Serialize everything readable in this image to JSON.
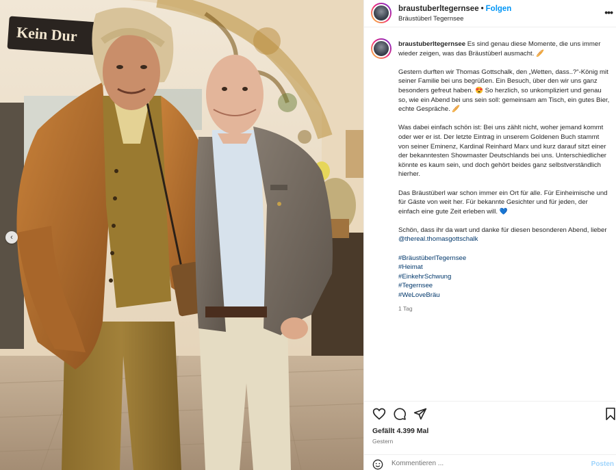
{
  "photo": {
    "sign_text": "Kein Dur",
    "alt_subject": "two men posing"
  },
  "header": {
    "username": "braustuberltegernsee",
    "separator": "•",
    "follow_label": "Folgen",
    "location": "Bräustüberl Tegernsee",
    "more_icon": "more-horizontal-icon"
  },
  "caption": {
    "username": "braustuberltegernsee",
    "paragraphs": [
      "Es sind genau diese Momente, die uns immer wieder zeigen, was das Bräustüberl ausmacht. 🥖",
      "Gestern durften wir Thomas Gottschalk, den „Wetten, dass..?“-König mit seiner Familie bei uns begrüßen. Ein Besuch, über den wir uns ganz besonders gefreut haben. 😍 So herzlich, so unkompliziert und genau so, wie ein Abend bei uns sein soll: gemeinsam am Tisch, ein gutes Bier, echte Gespräche. 🥖",
      "Was dabei einfach schön ist: Bei uns zählt nicht, woher jemand kommt oder wer er ist. Der letzte Eintrag in unserem Goldenen Buch stammt von seiner Eminenz, Kardinal Reinhard Marx und kurz darauf sitzt einer der bekanntesten Showmaster Deutschlands bei uns. Unterschiedlicher könnte es kaum sein, und doch gehört beides ganz selbstverständlich hierher.",
      "Das Bräustüberl war schon immer ein Ort für alle. Für Einheimische und für Gäste von weit her. Für bekannte Gesichter und für jeden, der einfach eine gute Zeit erleben will. 💙"
    ],
    "closing_text": "Schön, dass ihr da wart und danke für diesen besonderen Abend, lieber",
    "mention": "@thereal.thomasgottschalk",
    "hashtags": [
      "#BräustüberlTegernsee",
      "#Heimat",
      "#EinkehrSchwung",
      "#Tegernsee",
      "#WeLoveBräu"
    ],
    "time_ago": "1 Tag"
  },
  "actions": {
    "like_icon": "heart-icon",
    "comment_icon": "comment-icon",
    "share_icon": "share-icon",
    "save_icon": "bookmark-icon"
  },
  "likes_text": "Gefällt 4.399 Mal",
  "date_text": "Gestern",
  "comment": {
    "placeholder": "Kommentieren ...",
    "post_label": "Posten"
  },
  "carousel": {
    "prev_icon": "chevron-left-icon"
  }
}
